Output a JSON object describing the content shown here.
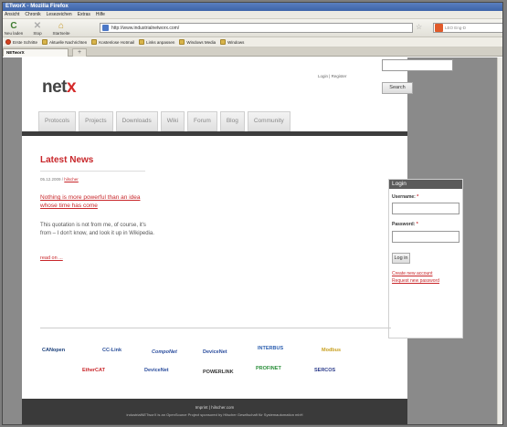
{
  "window": {
    "title": "ETworX - Mozilla Firefox"
  },
  "menu": [
    "Ansicht",
    "Chronik",
    "Lesezeichen",
    "Extras",
    "Hilfe"
  ],
  "toolbar": {
    "reload": "Neu laden",
    "stop": "Stop",
    "home": "Startseite",
    "url": "http://www.industrialnetworx.com/",
    "search_placeholder": "LEO Eng-D"
  },
  "bookmarks": [
    "Erste Schritte",
    "Aktuelle Nachrichten",
    "Kostenlose Hotmail",
    "Links anpassen",
    "Windows Media",
    "Windows"
  ],
  "tabs": {
    "active": "NETworX",
    "new": "+"
  },
  "site": {
    "logo_main": "net",
    "logo_accent": "x",
    "login_links": "Login | Register",
    "search_button": "Search",
    "nav": [
      "Protocols",
      "Projects",
      "Downloads",
      "Wiki",
      "Forum",
      "Blog",
      "Community"
    ]
  },
  "news": {
    "title": "Latest News",
    "date": "05.12.2009 /",
    "author": "hilscher",
    "headline": "Nothing is more powerful than an idea whose time has come",
    "body": "This quotation is not from me, of course, it's from – I don't know, and look it up in Wikipedia.",
    "read_on": "read on ..."
  },
  "login": {
    "header": "Login",
    "username_label": "Username:",
    "password_label": "Password:",
    "required_mark": "*",
    "button": "Log in",
    "create_account": "Create new account",
    "request_password": "Request new password"
  },
  "partners": [
    "CANopen",
    "CC-Link",
    "CompoNet",
    "DeviceNet",
    "INTERBUS",
    "Modbus",
    "EtherCAT",
    "DeviceNet",
    "POWERLINK",
    "PROFINET",
    "SERCOS"
  ],
  "footer": {
    "links": "Imprint | hilscher.com",
    "text": "industrialNETworX is an OpenSource Project sponsored by Hilscher Gesellschaft für Systemautomation mbH"
  }
}
